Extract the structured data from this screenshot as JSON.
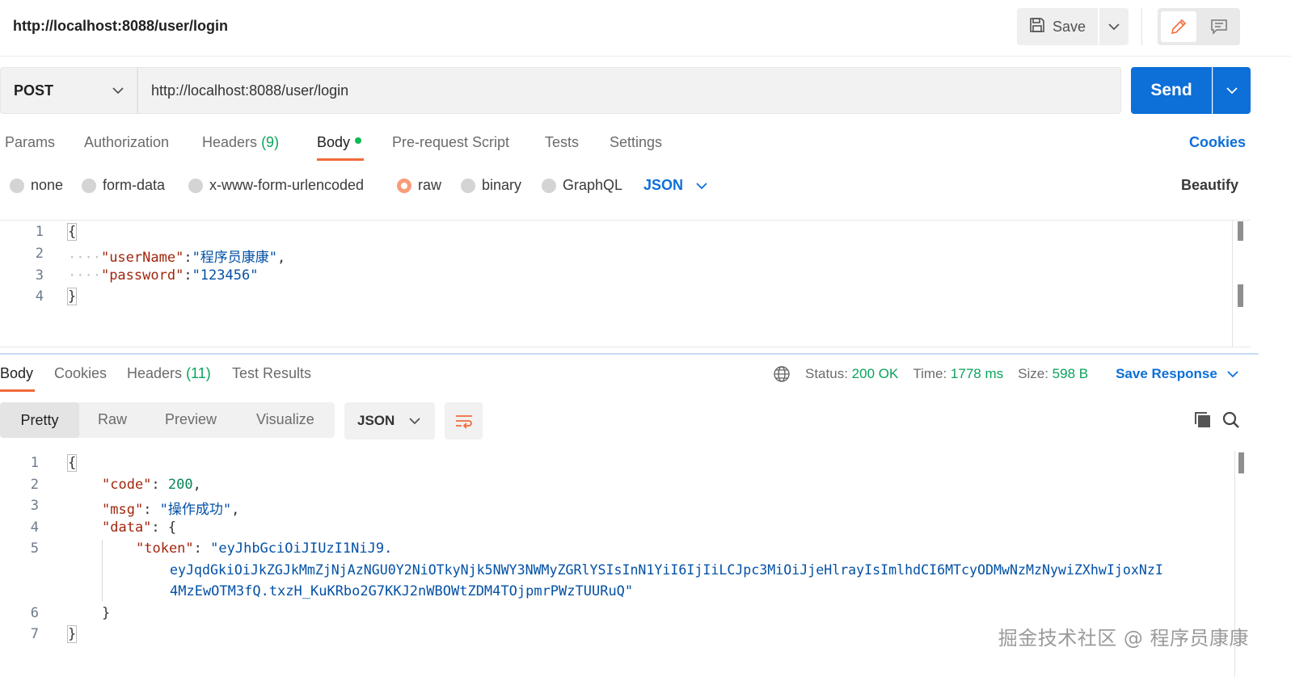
{
  "header": {
    "title": "http://localhost:8088/user/login",
    "save_label": "Save"
  },
  "request": {
    "method": "POST",
    "url": "http://localhost:8088/user/login",
    "send_label": "Send"
  },
  "request_tabs": {
    "params": "Params",
    "authorization": "Authorization",
    "headers": "Headers",
    "headers_count": "(9)",
    "body": "Body",
    "pre_request": "Pre-request Script",
    "tests": "Tests",
    "settings": "Settings",
    "cookies": "Cookies"
  },
  "body_types": {
    "none": "none",
    "form_data": "form-data",
    "urlencoded": "x-www-form-urlencoded",
    "raw": "raw",
    "binary": "binary",
    "graphql": "GraphQL",
    "format": "JSON",
    "beautify": "Beautify",
    "selected": "raw"
  },
  "request_body": {
    "line_numbers": [
      "1",
      "2",
      "3",
      "4"
    ],
    "open_brace": "{",
    "close_brace": "}",
    "k1": "\"userName\"",
    "v1": "\"程序员康康\"",
    "k2": "\"password\"",
    "v2": "\"123456\""
  },
  "response_tabs": {
    "body": "Body",
    "cookies": "Cookies",
    "headers": "Headers",
    "headers_count": "(11)",
    "test_results": "Test Results"
  },
  "response_status": {
    "status_label": "Status:",
    "status_value": "200 OK",
    "time_label": "Time:",
    "time_value": "1778 ms",
    "size_label": "Size:",
    "size_value": "598 B",
    "save_response": "Save Response"
  },
  "response_view": {
    "pretty": "Pretty",
    "raw": "Raw",
    "preview": "Preview",
    "visualize": "Visualize",
    "format": "JSON"
  },
  "response_body": {
    "line_numbers": [
      "1",
      "2",
      "3",
      "4",
      "5",
      "6",
      "7"
    ],
    "open_brace": "{",
    "close_brace": "}",
    "k_code": "\"code\"",
    "v_code": "200",
    "k_msg": "\"msg\"",
    "v_msg": "\"操作成功\"",
    "k_data": "\"data\"",
    "data_open": "{",
    "data_close": "}",
    "k_token": "\"token\"",
    "token_line1": "\"eyJhbGciOiJIUzI1NiJ9.",
    "token_line2": "eyJqdGkiOiJkZGJkMmZjNjAzNGU0Y2NiOTkyNjk5NWY3NWMyZGRlYSIsInN1YiI6IjIiLCJpc3MiOiJjeHlrayIsImlhdCI6MTcyODMwNzMzNywiZXhwIjoxNzI",
    "token_line3": "4MzEwOTM3fQ.txzH_KuKRbo2G7KKJ2nWBOWtZDM4TOjpmrPWzTUURuQ\""
  },
  "watermark": "掘金技术社区 @ 程序员康康",
  "colors": {
    "accent": "#0d6fd8",
    "active_tab": "#f26b3a",
    "success": "#0aa35c"
  }
}
